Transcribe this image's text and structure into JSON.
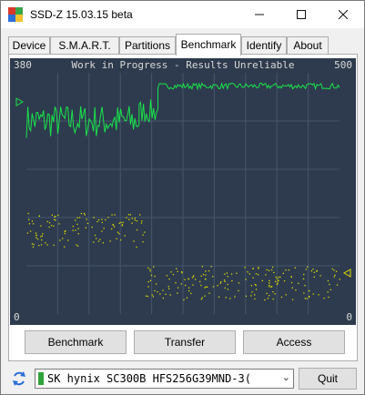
{
  "window": {
    "title": "SSD-Z 15.03.15 beta"
  },
  "controls": {
    "minimize_icon": "minimize-icon",
    "maximize_icon": "maximize-icon",
    "close_icon": "close-icon"
  },
  "tabs": [
    {
      "label": "Device"
    },
    {
      "label": "S.M.A.R.T."
    },
    {
      "label": "Partitions"
    },
    {
      "label": "Benchmark",
      "active": true
    },
    {
      "label": "Identify"
    },
    {
      "label": "About"
    }
  ],
  "chart_data": {
    "type": "scatter",
    "title": "Work in Progress - Results Unreliable",
    "left_axis_max": "380",
    "right_axis_max": "500",
    "left_axis_min": "0",
    "right_axis_min": "0",
    "colors": {
      "background": "#2e3b4e",
      "grid": "#46556b",
      "line": "#19e34a",
      "dots": "#d9d900",
      "text": "#d8d8d8"
    },
    "grid": true,
    "line_series": {
      "segments": [
        {
          "x_start": 0,
          "x_end": 0.36,
          "y_center": 0.8,
          "y_jitter": 0.07
        },
        {
          "x_start": 0.36,
          "x_end": 0.42,
          "y_center": 0.84,
          "y_jitter": 0.05
        },
        {
          "x_start": 0.42,
          "x_end": 1.0,
          "y_center": 0.945,
          "y_jitter": 0.012
        }
      ],
      "dip": {
        "x": 0.285,
        "y": 0.32
      }
    },
    "dots_series": {
      "segments": [
        {
          "x_start": 0,
          "x_end": 0.38,
          "y_min": 0.28,
          "y_max": 0.42
        },
        {
          "x_start": 0.38,
          "x_end": 1.0,
          "y_min": 0.06,
          "y_max": 0.2
        }
      ]
    }
  },
  "buttons": {
    "benchmark": "Benchmark",
    "transfer": "Transfer",
    "access": "Access"
  },
  "drive": {
    "selected": "SK hynix SC300B HFS256G39MND-3("
  },
  "quit_label": "Quit"
}
